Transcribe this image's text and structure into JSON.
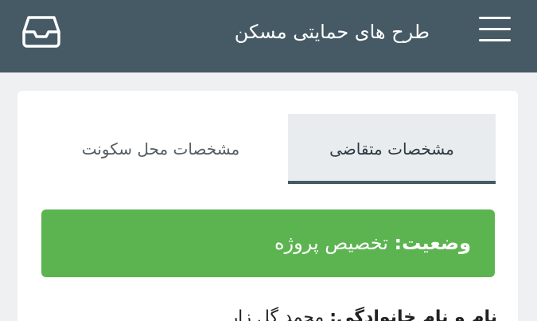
{
  "header": {
    "title": "طرح های حمایتی مسکن",
    "menu_icon": "hamburger-menu-icon",
    "inbox_icon": "inbox-tray-icon",
    "background_color": "#465a65"
  },
  "tabs": [
    {
      "label": "مشخصات متقاضی",
      "active": true
    },
    {
      "label": "مشخصات محل سکونت",
      "active": false
    }
  ],
  "status": {
    "label": "وضعیت:",
    "value": "تخصیص پروژه",
    "color": "#5cb451"
  },
  "fields": {
    "first_label": "نام و نام خانوادگی:",
    "first_value": "محمد گل زار"
  }
}
